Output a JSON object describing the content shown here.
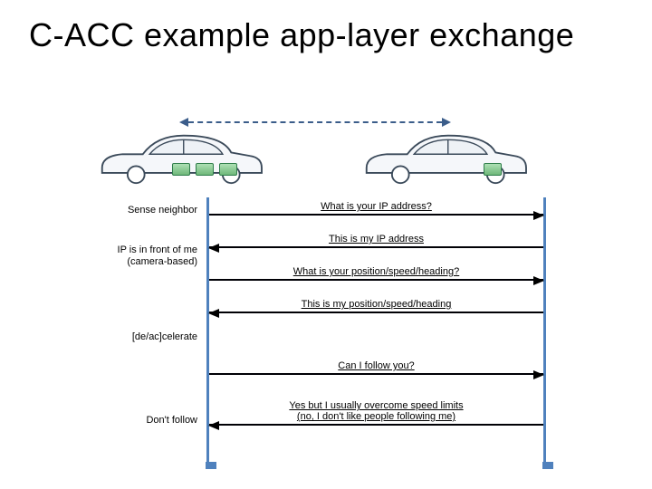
{
  "title": "C-ACC example app-layer exchange",
  "left_labels": {
    "sense": "Sense neighbor",
    "ip_front": "IP is in front of me\n(camera-based)",
    "deac": "[de/ac]celerate",
    "dont_follow": "Don't follow"
  },
  "messages": {
    "m1": "What is your IP address?",
    "m2": "This is my IP address",
    "m3": "What is your position/speed/heading?",
    "m4": "This is my position/speed/heading",
    "m5": "Can I follow you?",
    "m6": "Yes but I usually overcome speed limits\n(no, I don't like people following me)"
  }
}
